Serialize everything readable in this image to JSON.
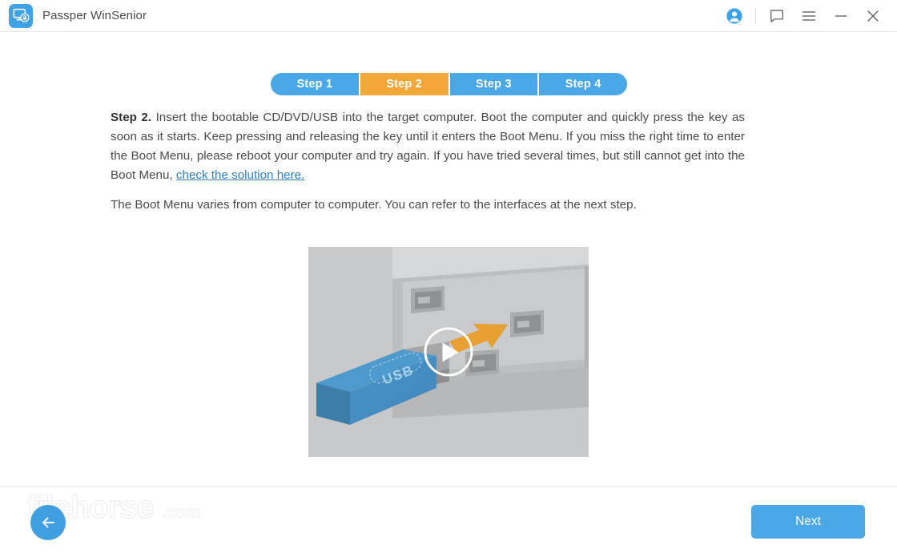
{
  "window": {
    "title": "Passper WinSenior",
    "logo_icon": "monitor-lock-icon",
    "controls": [
      {
        "name": "account-icon",
        "glyph": "account"
      },
      {
        "name": "feedback-icon",
        "glyph": "chat"
      },
      {
        "name": "menu-icon",
        "glyph": "hamburger"
      },
      {
        "name": "minimize-icon",
        "glyph": "minimize"
      },
      {
        "name": "close-icon",
        "glyph": "close"
      }
    ]
  },
  "steps": {
    "active_index": 1,
    "items": [
      {
        "label": "Step 1"
      },
      {
        "label": "Step 2"
      },
      {
        "label": "Step 3"
      },
      {
        "label": "Step 4"
      }
    ],
    "active_color": "#f5a83a",
    "inactive_color": "#4aa8e6"
  },
  "instructions": {
    "step_label": "Step 2.",
    "body_before_link": " Insert the bootable CD/DVD/USB into the target computer. Boot the computer and quickly press the key as soon as it starts. Keep pressing and releasing the key until it enters the Boot Menu. If you miss the right time to enter the Boot Menu, please reboot your computer and try again. If you have tried several times, but still cannot get into the Boot Menu, ",
    "link_text": "check the solution here.",
    "link_color": "#2e7fc4",
    "note": "The Boot Menu varies from computer to computer. You can refer to the interfaces at the next step."
  },
  "media": {
    "name": "usb-insert-video-thumbnail",
    "label": "USB",
    "play_button": "play-icon"
  },
  "footer": {
    "back_label": "",
    "back_icon": "arrow-left-icon",
    "next_label": "Next",
    "next_color": "#4aa8e6"
  },
  "watermark": {
    "text": "filehorse.com"
  }
}
